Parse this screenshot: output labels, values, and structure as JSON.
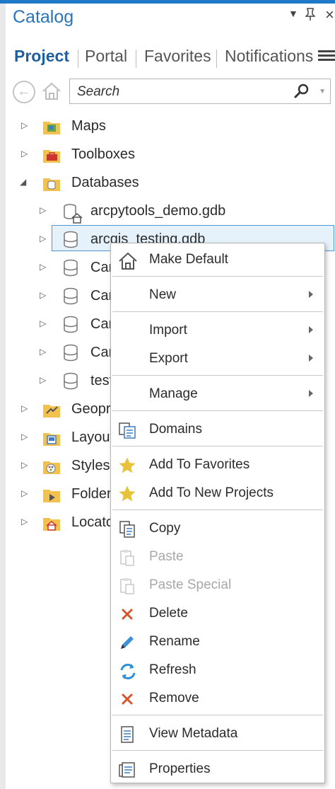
{
  "pane": {
    "title": "Catalog",
    "controls": {
      "menu_glyph": "▼",
      "pin_glyph": "📌",
      "close_glyph": "×"
    }
  },
  "tabs": [
    {
      "label": "Project",
      "active": true
    },
    {
      "label": "Portal",
      "active": false
    },
    {
      "label": "Favorites",
      "active": false
    },
    {
      "label": "Notifications",
      "active": false
    }
  ],
  "search": {
    "placeholder": "Search"
  },
  "tree": [
    {
      "label": "Maps",
      "icon": "maps-folder-icon",
      "expanded": false
    },
    {
      "label": "Toolboxes",
      "icon": "toolboxes-folder-icon",
      "expanded": false
    },
    {
      "label": "Databases",
      "icon": "databases-folder-icon",
      "expanded": true
    },
    {
      "label": "arcpytools_demo.gdb",
      "icon": "default-geodatabase-icon",
      "expanded": false
    },
    {
      "label": "arcgis_testing.gdb",
      "icon": "geodatabase-icon",
      "expanded": false,
      "selected": true
    },
    {
      "label": "Car",
      "icon": "geodatabase-icon",
      "expanded": false
    },
    {
      "label": "Car",
      "icon": "geodatabase-icon",
      "expanded": false
    },
    {
      "label": "Car",
      "icon": "geodatabase-icon",
      "expanded": false
    },
    {
      "label": "Car",
      "icon": "geodatabase-icon",
      "expanded": false
    },
    {
      "label": "test",
      "icon": "geodatabase-icon",
      "expanded": false
    },
    {
      "label": "Geopr",
      "icon": "geoprocessing-folder-icon",
      "expanded": false
    },
    {
      "label": "Layout",
      "icon": "layouts-folder-icon",
      "expanded": false
    },
    {
      "label": "Styles",
      "icon": "styles-folder-icon",
      "expanded": false
    },
    {
      "label": "Folder",
      "icon": "folders-folder-icon",
      "expanded": false
    },
    {
      "label": "Locato",
      "icon": "locators-folder-icon",
      "expanded": false
    }
  ],
  "context_menu": {
    "items": [
      {
        "label": "Make Default",
        "icon": "home-icon"
      },
      {
        "label": "New",
        "submenu": true
      },
      {
        "label": "Import",
        "submenu": true
      },
      {
        "label": "Export",
        "submenu": true
      },
      {
        "label": "Manage",
        "submenu": true
      },
      {
        "label": "Domains",
        "icon": "domains-icon"
      },
      {
        "label": "Add To Favorites",
        "icon": "star-icon"
      },
      {
        "label": "Add To New Projects",
        "icon": "star-icon"
      },
      {
        "label": "Copy",
        "icon": "copy-icon"
      },
      {
        "label": "Paste",
        "icon": "paste-icon",
        "disabled": true
      },
      {
        "label": "Paste Special",
        "icon": "paste-special-icon",
        "disabled": true
      },
      {
        "label": "Delete",
        "icon": "delete-x-icon"
      },
      {
        "label": "Rename",
        "icon": "pencil-icon"
      },
      {
        "label": "Refresh",
        "icon": "refresh-icon"
      },
      {
        "label": "Remove",
        "icon": "remove-x-icon"
      },
      {
        "label": "View Metadata",
        "icon": "metadata-icon"
      },
      {
        "label": "Properties",
        "icon": "properties-icon"
      }
    ]
  },
  "colors": {
    "accent": "#1f78c8",
    "title_blue": "#2a74b8",
    "selection_fill": "#e6f2fb",
    "selection_border": "#4f97d4",
    "folder_yellow": "#f2c14e",
    "star_gold": "#e8c23a",
    "delete_red": "#d9532c",
    "refresh_blue": "#2d8fd5"
  }
}
